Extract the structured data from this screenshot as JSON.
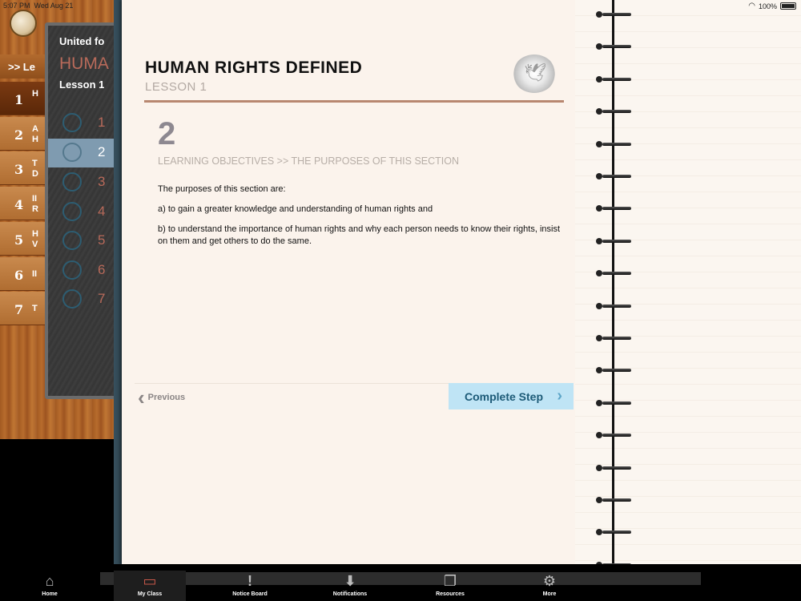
{
  "status": {
    "time": "5:07 PM",
    "date": "Wed Aug 21",
    "battery": "100%"
  },
  "sidebar": {
    "header": ">> Le",
    "items": [
      {
        "num": "1",
        "label": "H"
      },
      {
        "num": "2",
        "label": "A\nH"
      },
      {
        "num": "3",
        "label": "T\nD"
      },
      {
        "num": "4",
        "label": "II\nR"
      },
      {
        "num": "5",
        "label": "H\nV"
      },
      {
        "num": "6",
        "label": "II"
      },
      {
        "num": "7",
        "label": "T"
      }
    ]
  },
  "board": {
    "line1": "United fo",
    "line2": "HUMA",
    "line3": "Lesson 1",
    "steps": [
      "1",
      "2",
      "3",
      "4",
      "5",
      "6",
      "7"
    ],
    "active_step": "2"
  },
  "lesson": {
    "title": "HUMAN RIGHTS DEFINED",
    "subtitle": "LESSON 1",
    "step_number": "2",
    "section_heading": "LEARNING OBJECTIVES >> THE PURPOSES OF THIS SECTION",
    "paragraphs": [
      "The purposes of this section are:",
      "a) to gain a greater knowledge and understanding of human rights and",
      "b) to understand the importance of human rights and why each person needs to know their rights, insist on them and get others to do the same."
    ]
  },
  "navigation": {
    "previous_label": "Previous",
    "complete_label": "Complete Step"
  },
  "tabs": [
    {
      "label": "Home",
      "icon": "home-icon",
      "glyph": "⌂"
    },
    {
      "label": "My Class",
      "icon": "class-icon",
      "glyph": "▭"
    },
    {
      "label": "Notice Board",
      "icon": "notice-icon",
      "glyph": "!"
    },
    {
      "label": "Notifications",
      "icon": "inbox-icon",
      "glyph": "⬇"
    },
    {
      "label": "Resources",
      "icon": "resources-icon",
      "glyph": "❐"
    },
    {
      "label": "More",
      "icon": "gear-icon",
      "glyph": "⚙"
    }
  ],
  "colors": {
    "accent": "#bfe4f5",
    "rule": "#b88770",
    "active_tab": "#c9584a"
  }
}
